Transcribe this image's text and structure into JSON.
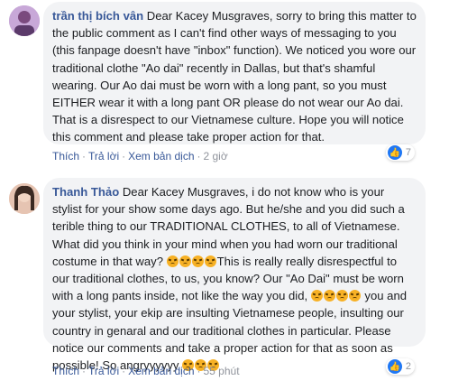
{
  "comments": [
    {
      "author": "trần thị bích vân",
      "segments": [
        {
          "text": "Dear Kacey Musgraves, sorry to bring this matter to the public comment as I can't find other ways of messaging to you (this fanpage doesn't have \"inbox\" function). We noticed you wore our traditional clothe \"Ao dai\" recently in Dallas, but that's shamful wearing. Our Ao dai must be worn with a long pant, so you must EITHER wear it with a long pant OR please do not wear our Ao dai. That is a disrespect to our Vietnamese culture. Hope you will notice this comment and please take proper action for that."
        }
      ],
      "actions": {
        "like": "Thích",
        "reply": "Trả lời",
        "translate": "Xem bản dịch",
        "time": "2 giờ"
      },
      "reaction_count": "7"
    },
    {
      "author": "Thanh Thảo",
      "segments": [
        {
          "text": "Dear Kacey Musgraves, i do not know who is your stylist for your show some days ago. But he/she and you did such a terible thing to our TRADITIONAL CLOTHES, to all of Vietnamese. What did you think in your mind when you had worn our traditional costume in that way? "
        },
        {
          "emoji": 4
        },
        {
          "text": "This is really really disrespectful to our traditional clothes, to us, you know? Our \"Ao Dai\" must be worn with a long pants inside, not like the way you did, "
        },
        {
          "emoji": 4
        },
        {
          "text": " you and your stylist, your ekip are insulting Vietnamese people, insulting our country in genaral and our traditional clothes in particular. Please notice our comments and take a proper action for that as soon as possible! So angryyyyyy "
        },
        {
          "emoji": 3
        }
      ],
      "actions": {
        "like": "Thích",
        "reply": "Trả lời",
        "translate": "Xem bản dịch",
        "time": "55 phút"
      },
      "reaction_count": "2"
    }
  ],
  "icons": {
    "reaction": "like-icon",
    "emoji": "angry-face-icon"
  }
}
